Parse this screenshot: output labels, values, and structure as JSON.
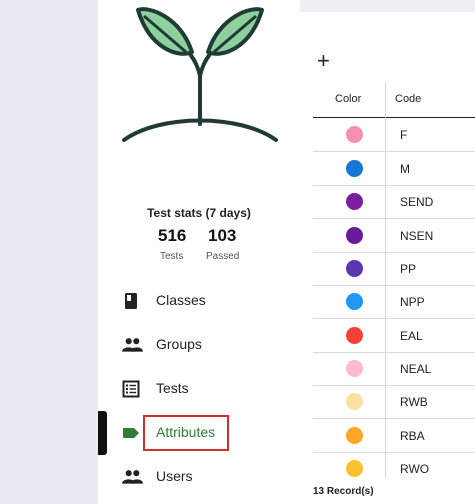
{
  "stats": {
    "title": "Test stats (7 days)",
    "tests_count": "516",
    "tests_label": "Tests",
    "passed_count": "103",
    "passed_label": "Passed"
  },
  "nav": [
    {
      "label": "Classes",
      "icon": "book-icon"
    },
    {
      "label": "Groups",
      "icon": "people-icon"
    },
    {
      "label": "Tests",
      "icon": "list-icon"
    },
    {
      "label": "Attributes",
      "icon": "tag-icon",
      "active": true
    },
    {
      "label": "Users",
      "icon": "users-icon"
    }
  ],
  "table": {
    "add_symbol": "+",
    "headers": {
      "color": "Color",
      "code": "Code"
    },
    "rows": [
      {
        "code": "F",
        "color": "#f48fb1"
      },
      {
        "code": "M",
        "color": "#1976d2"
      },
      {
        "code": "SEND",
        "color": "#7b1fa2"
      },
      {
        "code": "NSEN",
        "color": "#6a1b9a"
      },
      {
        "code": "PP",
        "color": "#5e35b1"
      },
      {
        "code": "NPP",
        "color": "#2196f3"
      },
      {
        "code": "EAL",
        "color": "#f44336"
      },
      {
        "code": "NEAL",
        "color": "#f8bbd0"
      },
      {
        "code": "RWB",
        "color": "#ffe0a3"
      },
      {
        "code": "RBA",
        "color": "#ffa726"
      },
      {
        "code": "RWO",
        "color": "#fbc02d"
      }
    ],
    "records": "13 Record(s)"
  },
  "colors": {
    "accent_green": "#2e7d32",
    "highlight_red": "#d32f2f",
    "leaf_fill": "#8fd19e",
    "leaf_stroke": "#1f3b34"
  }
}
